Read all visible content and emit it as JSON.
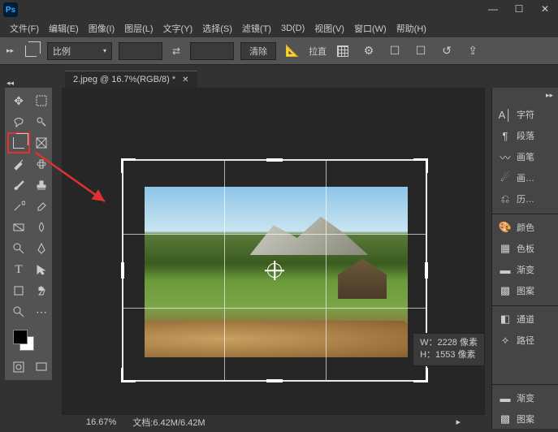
{
  "menu": {
    "file": "文件(F)",
    "edit": "编辑(E)",
    "image": "图像(I)",
    "layer": "图层(L)",
    "type": "文字(Y)",
    "select": "选择(S)",
    "filter": "滤镜(T)",
    "threed": "3D(D)",
    "view": "视图(V)",
    "window": "窗口(W)",
    "help": "帮助(H)"
  },
  "options": {
    "preset": "比例",
    "clear": "清除",
    "straighten": "拉直"
  },
  "document": {
    "tab": "2.jpeg @ 16.7%(RGB/8) *"
  },
  "dimensions": {
    "w_label": "W：",
    "w_val": "2228",
    "h_label": "H：",
    "h_val": "1553",
    "unit": "像素"
  },
  "status": {
    "zoom": "16.67%",
    "doc": "文档:",
    "size": "6.42M/6.42M"
  },
  "panels": {
    "char": "字符",
    "para": "段落",
    "brush": "画笔",
    "brush2": "画…",
    "history": "历…",
    "color": "颜色",
    "swatch": "色板",
    "grad": "渐变",
    "pattern": "图案",
    "channel": "通道",
    "path": "路径",
    "grad2": "渐变",
    "pattern2": "图案"
  }
}
